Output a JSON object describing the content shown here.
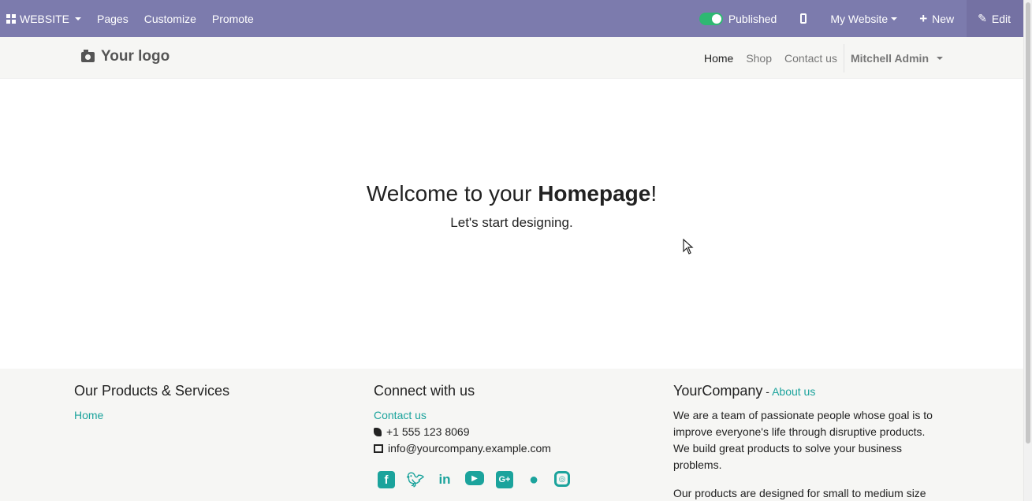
{
  "adminbar": {
    "app_label": "WEBSITE",
    "menu": [
      "Pages",
      "Customize",
      "Promote"
    ],
    "published_label": "Published",
    "website_label": "My Website",
    "new_label": "New",
    "edit_label": "Edit",
    "accent_color": "#7c7bad"
  },
  "header": {
    "logo_text": "Your logo",
    "nav": [
      "Home",
      "Shop",
      "Contact us"
    ],
    "user": "Mitchell Admin"
  },
  "hero": {
    "title_prefix": "Welcome to your ",
    "title_bold": "Homepage",
    "title_suffix": "!",
    "subtitle": "Let's start designing."
  },
  "footer": {
    "col1": {
      "title": "Our Products & Services",
      "links": [
        "Home"
      ]
    },
    "col2": {
      "title": "Connect with us",
      "contact_link": "Contact us",
      "phone": "+1 555 123 8069",
      "email": "info@yourcompany.example.com",
      "socials": [
        "facebook-icon",
        "twitter-icon",
        "linkedin-icon",
        "youtube-icon",
        "google-plus-icon",
        "github-icon",
        "instagram-icon"
      ]
    },
    "col3": {
      "company": "YourCompany",
      "separator": " - ",
      "about_link": "About us",
      "para1": "We are a team of passionate people whose goal is to improve everyone's life through disruptive products. We build great products to solve your business problems.",
      "para2": "Our products are designed for small to medium size"
    },
    "link_color": "#1ba39c"
  }
}
